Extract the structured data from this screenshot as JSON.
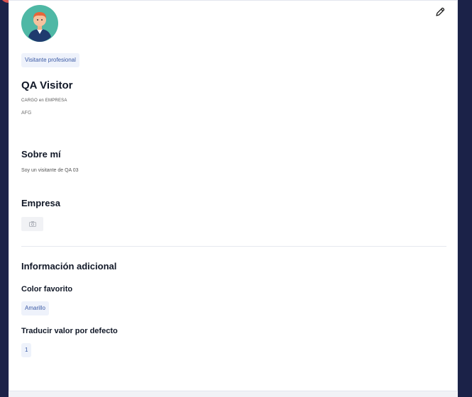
{
  "profile": {
    "role": "Visitante profesional",
    "name": "QA Visitor",
    "job_line": "CARGO en EMPRESA",
    "company_code": "AFG"
  },
  "about": {
    "title": "Sobre mí",
    "text": "Soy un visitante de QA 03"
  },
  "company": {
    "title": "Empresa"
  },
  "additional": {
    "title": "Información adicional",
    "fields": [
      {
        "label": "Color favorito",
        "value": "Amarillo"
      },
      {
        "label": "Traducir valor por defecto",
        "value": "1"
      }
    ]
  },
  "colors": {
    "accent": "#3b5aa5",
    "tag_bg": "#eef2fb",
    "sidebar": "#1f2750",
    "avatar_bg": "#4fb8a5"
  },
  "icons": {
    "edit": "pencil-icon",
    "avatar": "user-avatar",
    "camera": "camera-icon"
  }
}
